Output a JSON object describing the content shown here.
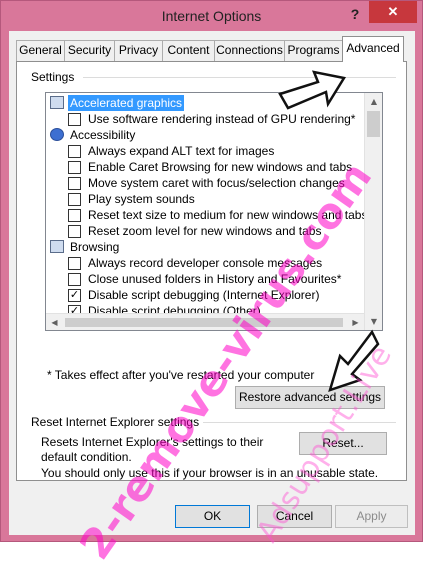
{
  "window": {
    "title": "Internet Options",
    "help_glyph": "?",
    "close_glyph": "✕"
  },
  "tabs": [
    {
      "label": "General"
    },
    {
      "label": "Security"
    },
    {
      "label": "Privacy"
    },
    {
      "label": "Content"
    },
    {
      "label": "Connections"
    },
    {
      "label": "Programs"
    },
    {
      "label": "Advanced",
      "active": true
    }
  ],
  "settings": {
    "label": "Settings",
    "tree": [
      {
        "type": "category",
        "icon": "monitor-icon",
        "label": "Accelerated graphics",
        "selected": true
      },
      {
        "type": "option",
        "label": "Use software rendering instead of GPU rendering*",
        "checked": false
      },
      {
        "type": "category",
        "icon": "accessibility-icon",
        "label": "Accessibility"
      },
      {
        "type": "option",
        "label": "Always expand ALT text for images",
        "checked": false
      },
      {
        "type": "option",
        "label": "Enable Caret Browsing for new windows and tabs",
        "checked": false
      },
      {
        "type": "option",
        "label": "Move system caret with focus/selection changes",
        "checked": false
      },
      {
        "type": "option",
        "label": "Play system sounds",
        "checked": false
      },
      {
        "type": "option",
        "label": "Reset text size to medium for new windows and tabs",
        "checked": false
      },
      {
        "type": "option",
        "label": "Reset zoom level for new windows and tabs",
        "checked": false
      },
      {
        "type": "category",
        "icon": "browsing-icon",
        "label": "Browsing"
      },
      {
        "type": "option",
        "label": "Always record developer console messages",
        "checked": false
      },
      {
        "type": "option",
        "label": "Close unused folders in History and Favourites*",
        "checked": false
      },
      {
        "type": "option",
        "label": "Disable script debugging (Internet Explorer)",
        "checked": true
      },
      {
        "type": "option",
        "label": "Disable script debugging (Other)",
        "checked": true
      }
    ],
    "footnote": "* Takes effect after you've restarted your computer",
    "restore_button": "Restore advanced settings"
  },
  "reset": {
    "label": "Reset Internet Explorer settings",
    "description": "Resets Internet Explorer's settings to their default condition.",
    "button": "Reset...",
    "warning": "You should only use this if your browser is in an unusable state."
  },
  "footer": {
    "ok": "OK",
    "cancel": "Cancel",
    "apply": "Apply"
  },
  "watermarks": {
    "main": "2-remove-virus.com",
    "secondary": "Adsupport.Live"
  },
  "colors": {
    "frame": "#d9779a",
    "close": "#c7373d",
    "selection": "#3399ff",
    "watermark": "#ff00c8"
  }
}
